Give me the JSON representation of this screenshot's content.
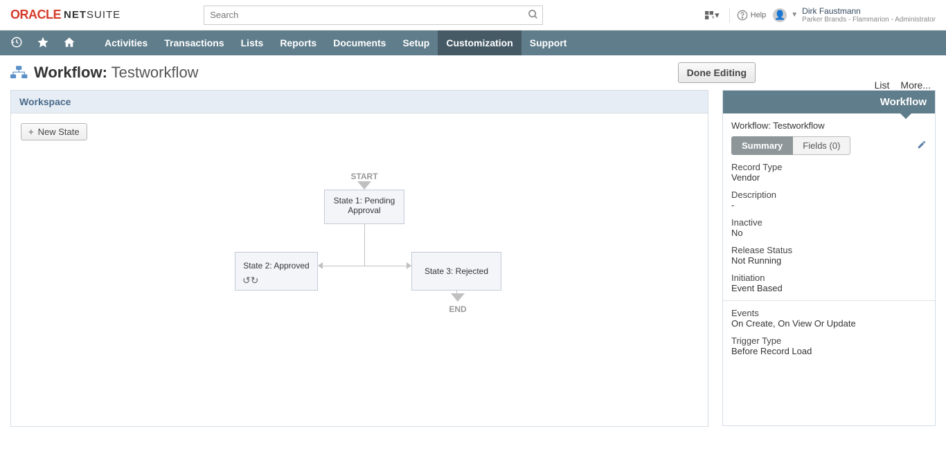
{
  "header": {
    "logo_oracle": "ORACLE",
    "logo_netsuite_bold": "NET",
    "logo_netsuite_light": "SUITE",
    "search_placeholder": "Search",
    "help_label": "Help",
    "user_name": "Dirk Faustmann",
    "user_role": "Parker Brands - Flammarion - Administrator"
  },
  "nav": {
    "items": [
      "Activities",
      "Transactions",
      "Lists",
      "Reports",
      "Documents",
      "Setup",
      "Customization",
      "Support"
    ],
    "active_index": 6
  },
  "page": {
    "title_prefix": "Workflow:",
    "title_name": "Testworkflow",
    "done_editing": "Done Editing",
    "link_list": "List",
    "link_more": "More..."
  },
  "workspace": {
    "header": "Workspace",
    "new_state": "New State",
    "start_label": "START",
    "end_label": "END",
    "state1": "State 1: Pending Approval",
    "state2": "State 2: Approved",
    "state3": "State 3: Rejected"
  },
  "sidepanel": {
    "header": "Workflow",
    "title": "Workflow: Testworkflow",
    "tabs": {
      "summary": "Summary",
      "fields": "Fields (0)"
    },
    "fields": {
      "record_type_label": "Record Type",
      "record_type_value": "Vendor",
      "description_label": "Description",
      "description_value": "-",
      "inactive_label": "Inactive",
      "inactive_value": "No",
      "release_status_label": "Release Status",
      "release_status_value": "Not Running",
      "initiation_label": "Initiation",
      "initiation_value": "Event Based",
      "events_label": "Events",
      "events_value": "On Create, On View Or Update",
      "trigger_type_label": "Trigger Type",
      "trigger_type_value": "Before Record Load"
    }
  }
}
